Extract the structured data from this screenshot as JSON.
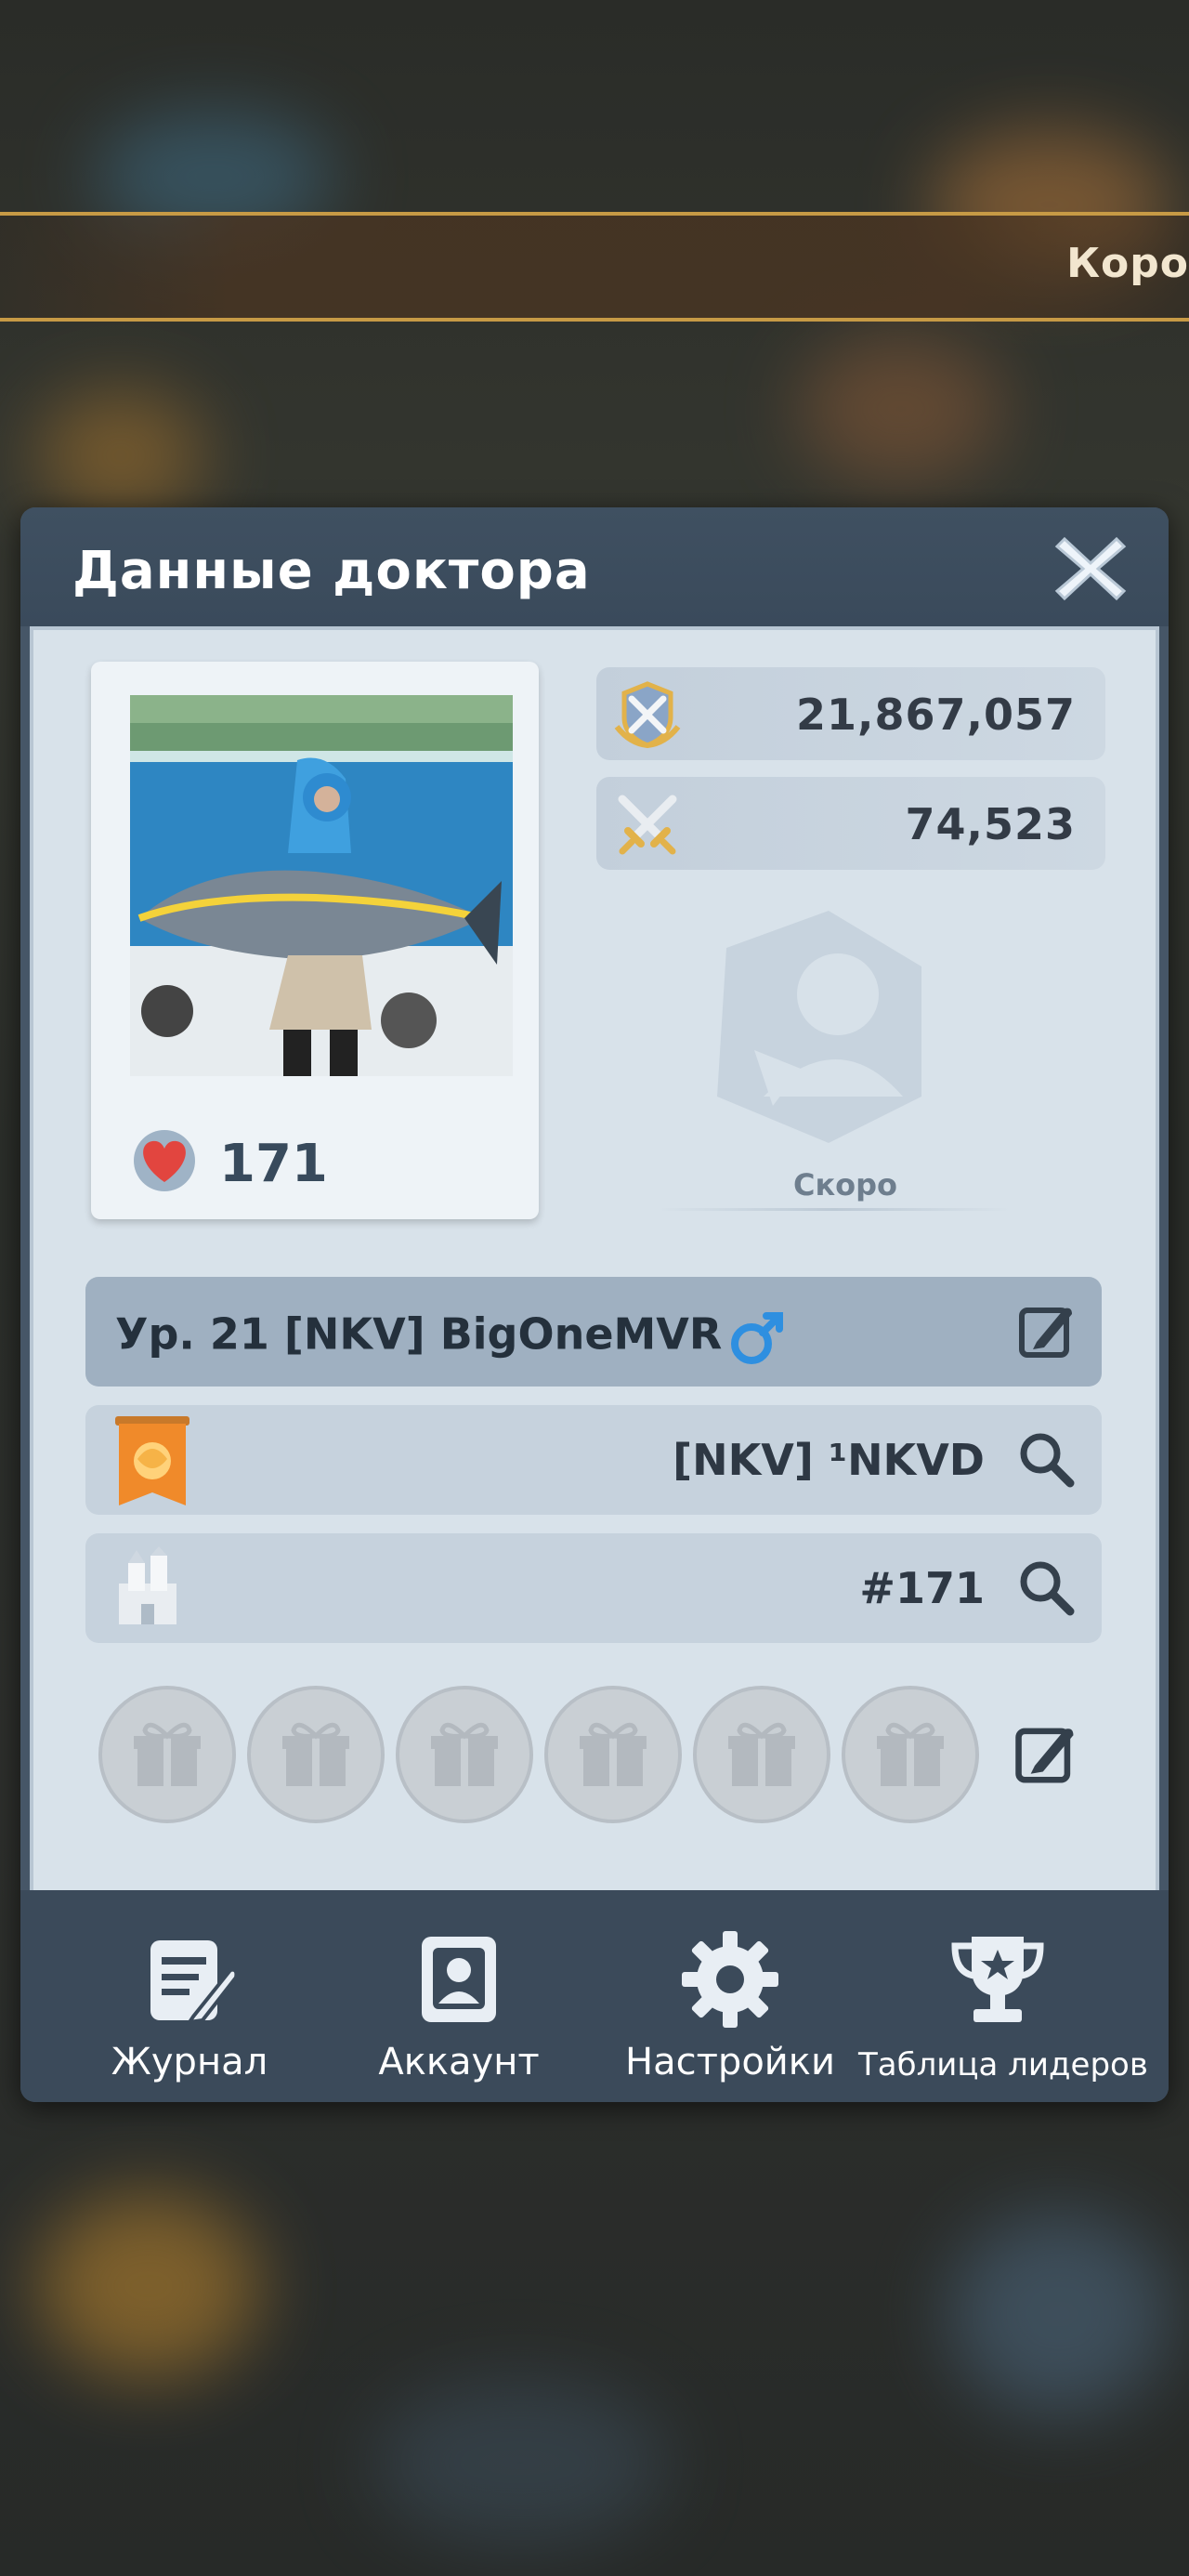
{
  "background": {
    "banner_text": "Коро"
  },
  "dialog": {
    "title": "Данные доктора"
  },
  "profile": {
    "likes": "171",
    "power": "21,867,057",
    "kills": "74,523",
    "soon_label": "Скоро",
    "name_line": "Ур. 21 [NKV] BigOneMVR",
    "guild": "[NKV] ¹NKVD",
    "rank": "#171"
  },
  "gifts": {
    "slots": [
      "gift-icon",
      "gift-icon",
      "gift-icon",
      "gift-icon",
      "gift-icon",
      "gift-icon"
    ]
  },
  "nav": {
    "items": [
      {
        "label": "Журнал",
        "icon": "journal-icon"
      },
      {
        "label": "Аккаунт",
        "icon": "account-icon"
      },
      {
        "label": "Настройки",
        "icon": "gear-icon"
      },
      {
        "label": "Таблица лидеров",
        "icon": "trophy-icon"
      }
    ]
  },
  "colors": {
    "panel": "#465667",
    "body": "#d8e2ea",
    "accent_gold": "#c79a45",
    "heart": "#e2453f"
  }
}
